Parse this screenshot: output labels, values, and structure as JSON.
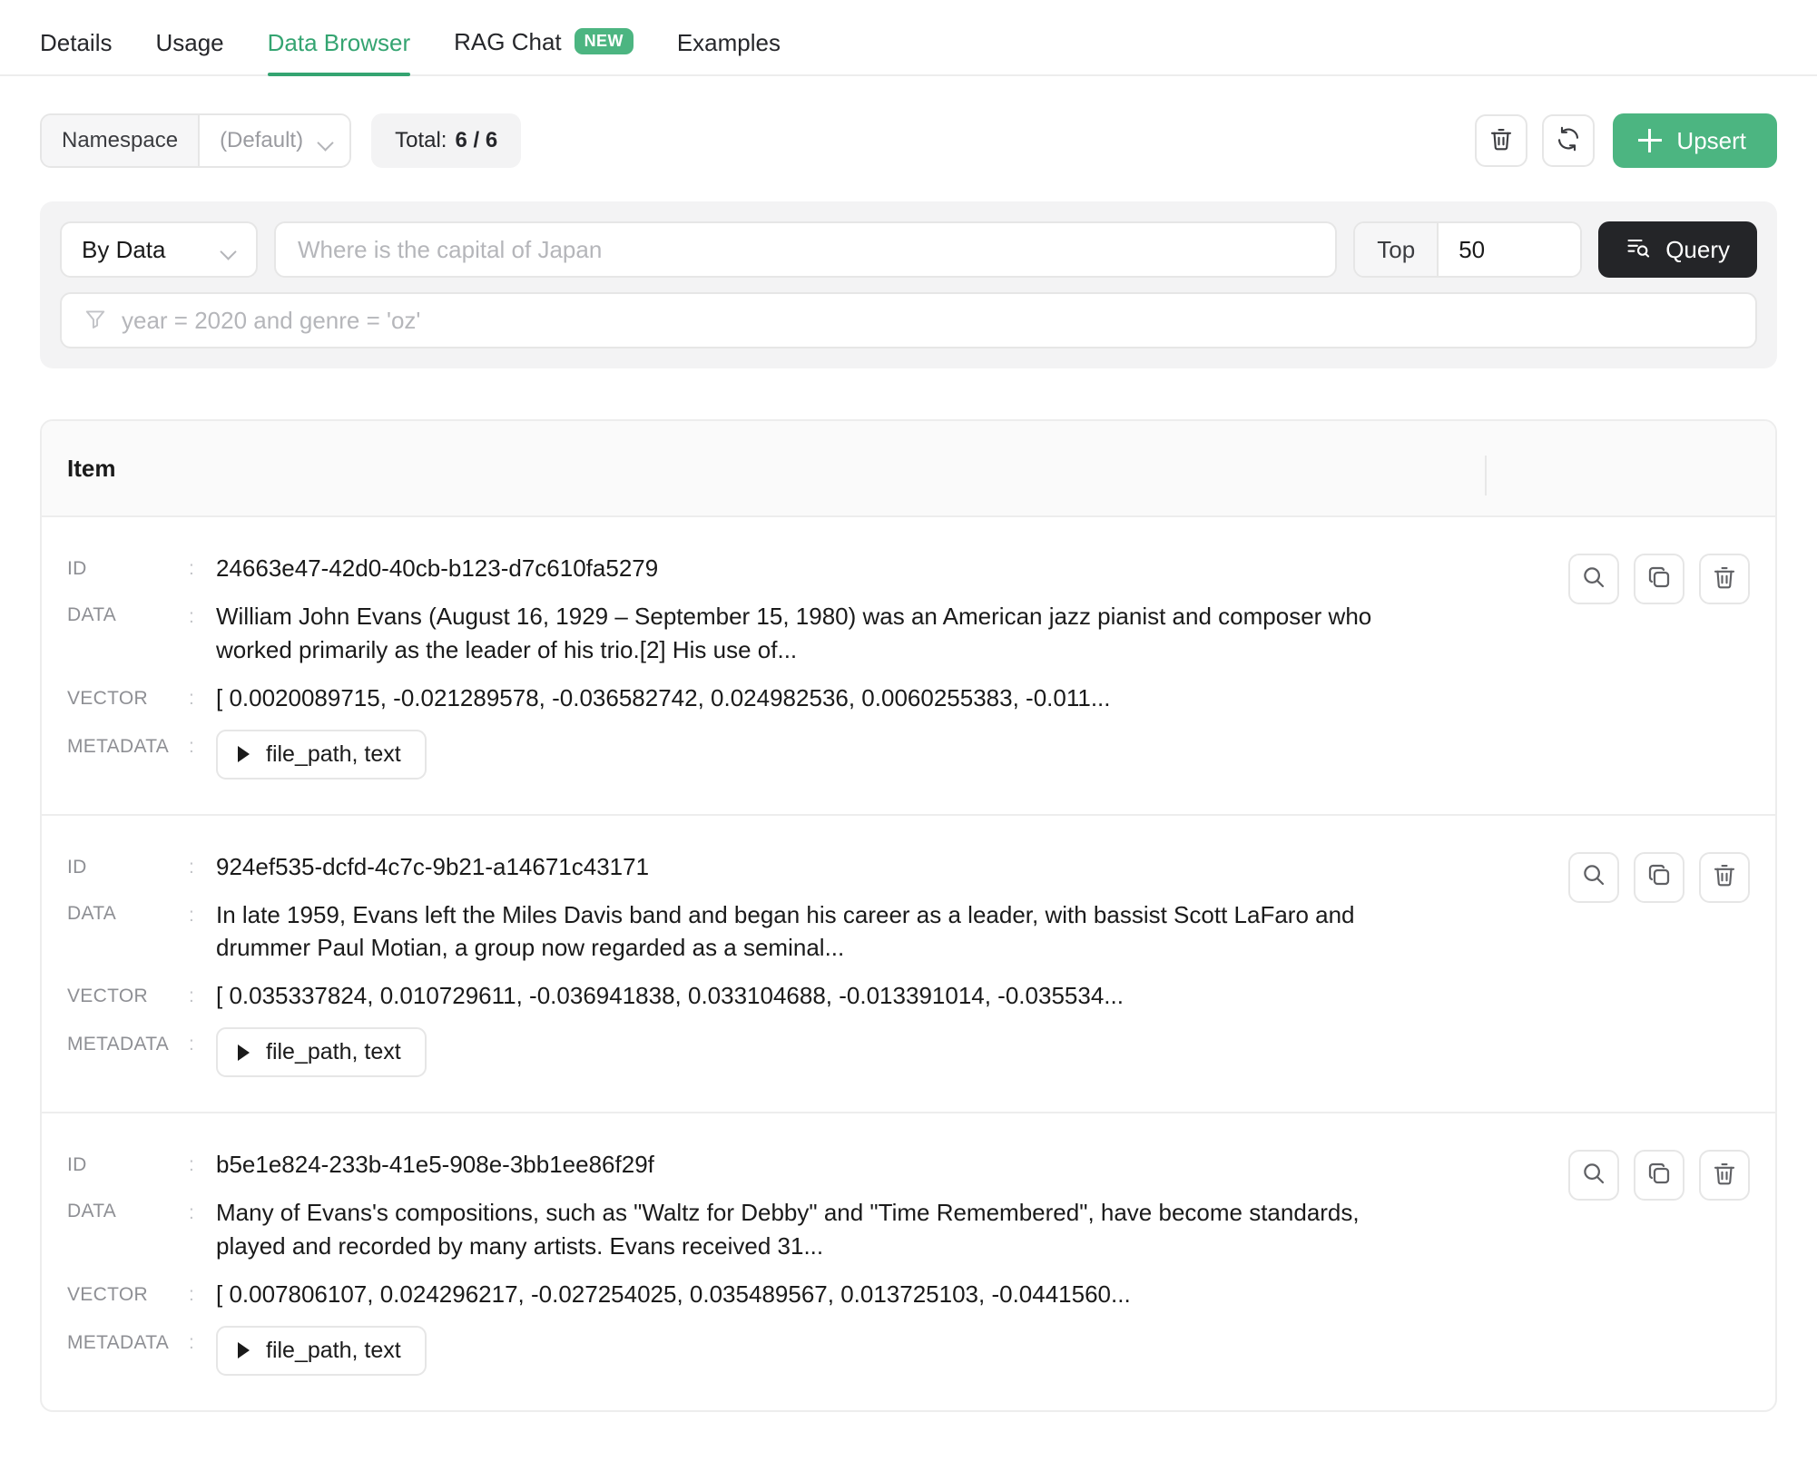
{
  "tabs": [
    {
      "label": "Details",
      "active": false,
      "badge": null
    },
    {
      "label": "Usage",
      "active": false,
      "badge": null
    },
    {
      "label": "Data Browser",
      "active": true,
      "badge": null
    },
    {
      "label": "RAG Chat",
      "active": false,
      "badge": "NEW"
    },
    {
      "label": "Examples",
      "active": false,
      "badge": null
    }
  ],
  "toolbar": {
    "namespace_label": "Namespace",
    "namespace_value": "(Default)",
    "total_prefix": "Total:",
    "total_value": "6 / 6",
    "delete_icon": "trash-icon",
    "refresh_icon": "refresh-icon",
    "upsert_label": "Upsert"
  },
  "query": {
    "mode_label": "By Data",
    "search_placeholder": "Where is the capital of Japan",
    "search_value": "",
    "top_label": "Top",
    "top_value": "50",
    "query_button_label": "Query",
    "filter_placeholder": "year = 2020 and genre = 'oz'",
    "filter_value": ""
  },
  "table": {
    "header": "Item",
    "field_labels": {
      "id": "ID",
      "data": "DATA",
      "vector": "VECTOR",
      "metadata": "METADATA"
    },
    "colon": ":",
    "row_actions": [
      "inspect-icon",
      "copy-icon",
      "delete-icon"
    ],
    "rows": [
      {
        "id": "24663e47-42d0-40cb-b123-d7c610fa5279",
        "data": "William John Evans (August 16, 1929 – September 15, 1980) was an American jazz pianist and composer who worked primarily as the leader of his trio.[2] His use of...",
        "vector": "[ 0.0020089715, -0.021289578, -0.036582742, 0.024982536, 0.0060255383, -0.011...",
        "metadata": "file_path, text"
      },
      {
        "id": "924ef535-dcfd-4c7c-9b21-a14671c43171",
        "data": "In late 1959, Evans left the Miles Davis band and began his career as a leader, with bassist Scott LaFaro and drummer Paul Motian, a group now regarded as a seminal...",
        "vector": "[ 0.035337824, 0.010729611, -0.036941838, 0.033104688, -0.013391014, -0.035534...",
        "metadata": "file_path, text"
      },
      {
        "id": "b5e1e824-233b-41e5-908e-3bb1ee86f29f",
        "data": "Many of Evans's compositions, such as \"Waltz for Debby\" and \"Time Remembered\", have become standards, played and recorded by many artists. Evans received 31...",
        "vector": "[ 0.007806107, 0.024296217, -0.027254025, 0.035489567, 0.013725103, -0.0441560...",
        "metadata": "file_path, text"
      }
    ]
  },
  "colors": {
    "accent_green": "#34a471",
    "badge_green": "#4cb581",
    "query_dark": "#242528",
    "panel_gray": "#f3f3f4",
    "border_gray": "#ededed"
  }
}
